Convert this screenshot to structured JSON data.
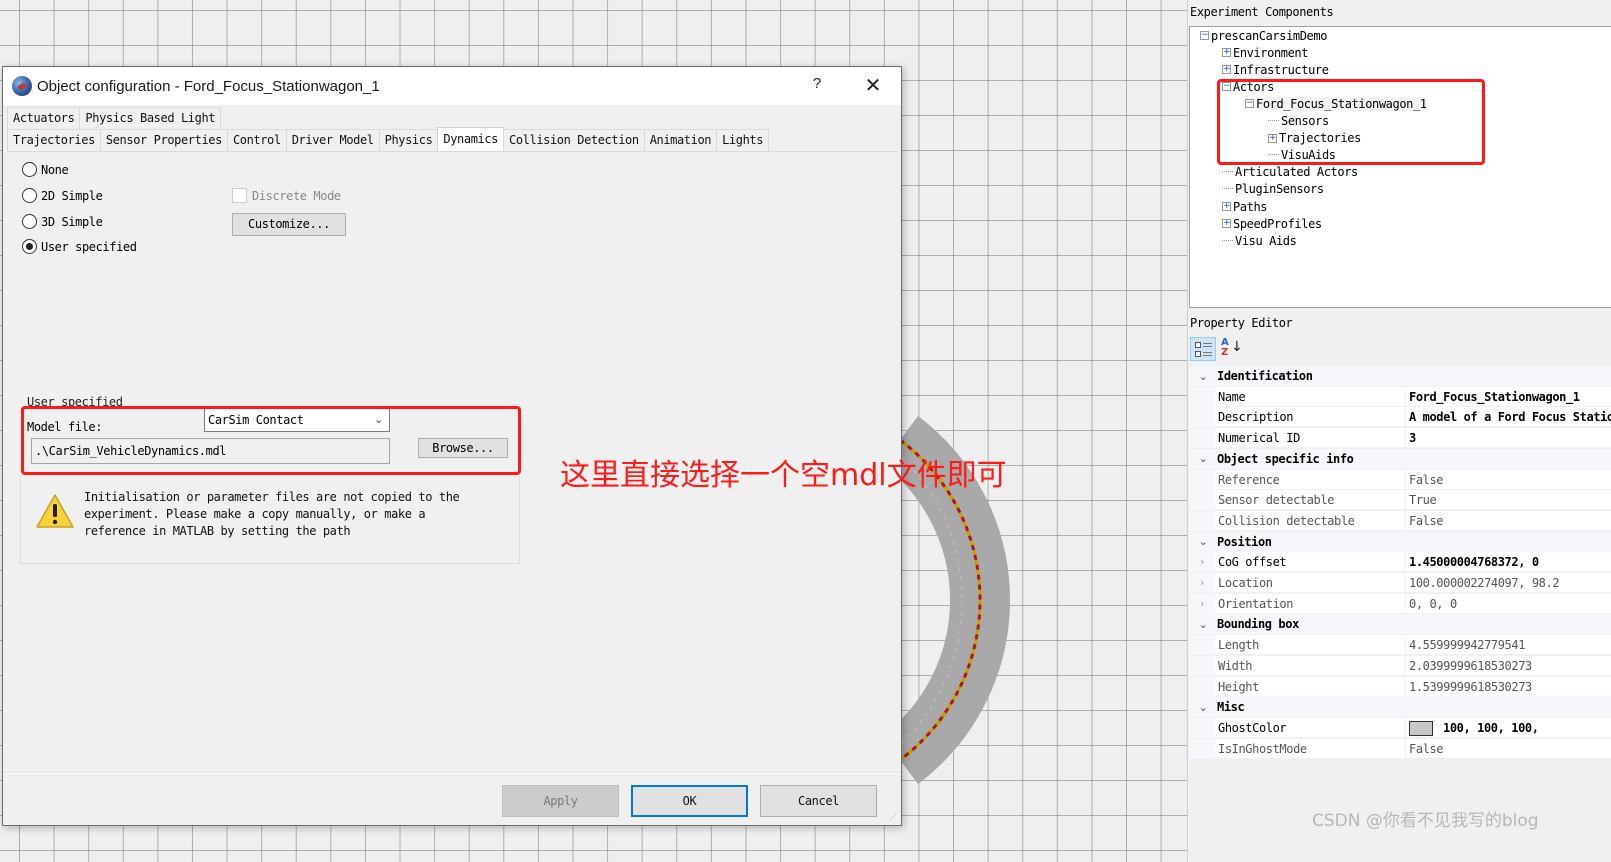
{
  "dialog": {
    "title": "Object configuration - Ford_Focus_Stationwagon_1",
    "help_label": "?",
    "close_label": "✕",
    "tabs_row1": [
      {
        "label": "Actuators"
      },
      {
        "label": "Physics Based Light"
      }
    ],
    "tabs_row2": [
      {
        "label": "Trajectories"
      },
      {
        "label": "Sensor Properties"
      },
      {
        "label": "Control"
      },
      {
        "label": "Driver Model"
      },
      {
        "label": "Physics"
      },
      {
        "label": "Dynamics",
        "active": true
      },
      {
        "label": "Collision Detection"
      },
      {
        "label": "Animation"
      },
      {
        "label": "Lights"
      }
    ],
    "dynamics": {
      "options": [
        {
          "label": "None",
          "checked": false
        },
        {
          "label": "2D Simple",
          "checked": false
        },
        {
          "label": "3D Simple",
          "checked": false
        },
        {
          "label": "User specified",
          "checked": true
        }
      ],
      "discrete_mode_label": "Discrete Mode",
      "discrete_mode_checked": false,
      "customize_label": "Customize...",
      "user_specified_group_label": "User specified",
      "model_file_label": "Model file:",
      "model_select_value": "CarSim Contact",
      "model_path_value": ".\\CarSim_VehicleDynamics.mdl",
      "browse_label": "Browse...",
      "warning_text": "Initialisation or parameter files are not copied to the\nexperiment. Please make a copy manually, or make a\nreference in MATLAB by setting the path"
    },
    "buttons": {
      "apply": "Apply",
      "ok": "OK",
      "cancel": "Cancel"
    }
  },
  "annotation": {
    "text": "这里直接选择一个空mdl文件即可",
    "color": "#ff1a1a"
  },
  "experiment_components": {
    "label": "Experiment Components",
    "tree": [
      {
        "label": "prescanCarsimDemo",
        "depth": 0,
        "expander": "minus"
      },
      {
        "label": "Environment",
        "depth": 1,
        "expander": "plus"
      },
      {
        "label": "Infrastructure",
        "depth": 1,
        "expander": "plus"
      },
      {
        "label": "Actors",
        "depth": 1,
        "expander": "minus"
      },
      {
        "label": "Ford_Focus_Stationwagon_1",
        "depth": 2,
        "expander": "minus",
        "selected": true
      },
      {
        "label": "Sensors",
        "depth": 3,
        "expander": "none"
      },
      {
        "label": "Trajectories",
        "depth": 3,
        "expander": "plus"
      },
      {
        "label": "VisuAids",
        "depth": 3,
        "expander": "none"
      },
      {
        "label": "Articulated Actors",
        "depth": 1,
        "expander": "none"
      },
      {
        "label": "PluginSensors",
        "depth": 1,
        "expander": "none"
      },
      {
        "label": "Paths",
        "depth": 1,
        "expander": "plus"
      },
      {
        "label": "SpeedProfiles",
        "depth": 1,
        "expander": "plus"
      },
      {
        "label": "Visu Aids",
        "depth": 1,
        "expander": "none"
      }
    ]
  },
  "property_editor": {
    "label": "Property Editor",
    "toolbar": {
      "categorized_icon": "categorized-view-icon",
      "alphabetical_icon": "sort-alphabetical-icon"
    },
    "categories": [
      {
        "name": "Identification",
        "props": [
          {
            "name": "Name",
            "value": "Ford_Focus_Stationwagon_1",
            "bold": true
          },
          {
            "name": "Description",
            "value": "A model of a Ford Focus Stationwagon",
            "bold": true
          },
          {
            "name": "Numerical ID",
            "value": "3",
            "bold": true
          }
        ]
      },
      {
        "name": "Object specific info",
        "props": [
          {
            "name": "Reference",
            "value": "False"
          },
          {
            "name": "Sensor detectable",
            "value": "True"
          },
          {
            "name": "Collision detectable",
            "value": "False"
          }
        ]
      },
      {
        "name": "Position",
        "props": [
          {
            "name": "CoG offset",
            "value": "1.45000004768372, 0",
            "bold": true,
            "expandable": true
          },
          {
            "name": "Location",
            "value": "100.000002274097, 98.2",
            "expandable": true
          },
          {
            "name": "Orientation",
            "value": "0, 0, 0",
            "expandable": true
          }
        ]
      },
      {
        "name": "Bounding box",
        "props": [
          {
            "name": "Length",
            "value": "4.559999942779541"
          },
          {
            "name": "Width",
            "value": "2.0399999618530273"
          },
          {
            "name": "Height",
            "value": "1.5399999618530273"
          }
        ]
      },
      {
        "name": "Misc",
        "props": [
          {
            "name": "GhostColor",
            "value": "100, 100, 100,",
            "bold": true,
            "swatch": "#c8c8c8"
          },
          {
            "name": "IsInGhostMode",
            "value": "False"
          }
        ]
      }
    ]
  },
  "watermark": "CSDN @你看不见我写的blog"
}
